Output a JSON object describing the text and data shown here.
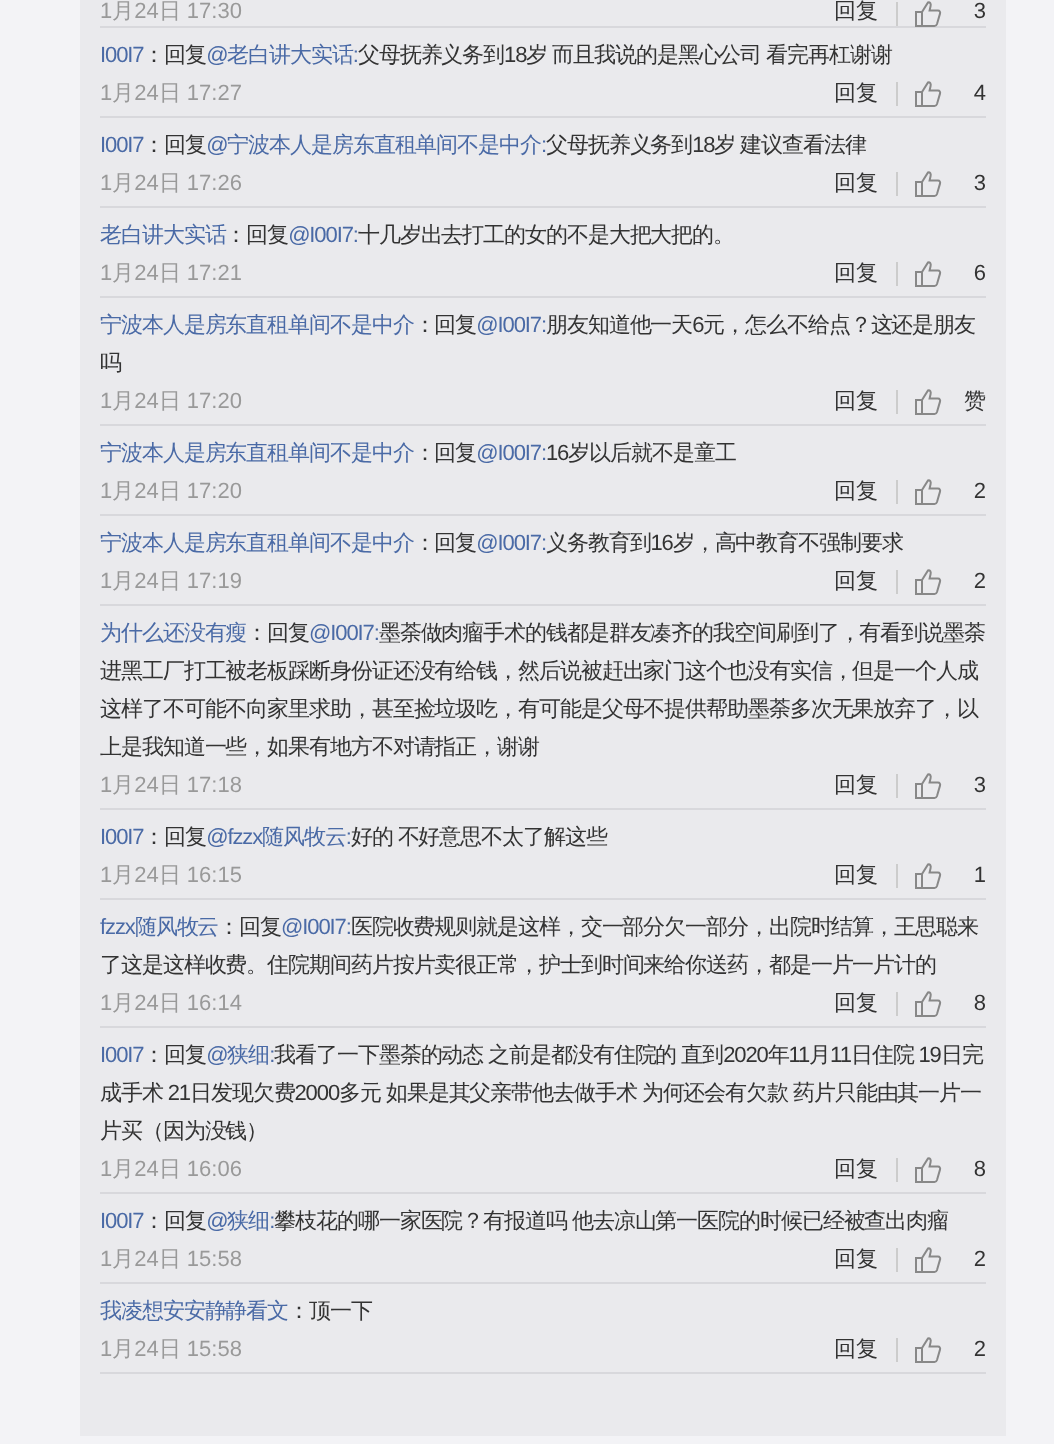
{
  "partial_top": {
    "time": "1月24日 17:30",
    "reply": "回复",
    "likes": "3"
  },
  "comments": [
    {
      "user": "I00I7",
      "reply_word": "：回复",
      "mention": "@老白讲大实话:",
      "text": "父母抚养义务到18岁 而且我说的是黑心公司 看完再杠谢谢",
      "time": "1月24日 17:27",
      "reply": "回复",
      "likes": "4"
    },
    {
      "user": "I00I7",
      "reply_word": "：回复",
      "mention": "@宁波本人是房东直租单间不是中介:",
      "text": "父母抚养义务到18岁 建议查看法律",
      "time": "1月24日 17:26",
      "reply": "回复",
      "likes": "3"
    },
    {
      "user": "老白讲大实话",
      "reply_word": "：回复",
      "mention": "@I00I7:",
      "text": "十几岁出去打工的女的不是大把大把的。",
      "time": "1月24日 17:21",
      "reply": "回复",
      "likes": "6"
    },
    {
      "user": "宁波本人是房东直租单间不是中介",
      "reply_word": "：回复",
      "mention": "@I00I7:",
      "text": "朋友知道他一天6元，怎么不给点？这还是朋友吗",
      "time": "1月24日 17:20",
      "reply": "回复",
      "likes": "赞"
    },
    {
      "user": "宁波本人是房东直租单间不是中介",
      "reply_word": "：回复",
      "mention": "@I00I7:",
      "text": "16岁以后就不是童工",
      "time": "1月24日 17:20",
      "reply": "回复",
      "likes": "2"
    },
    {
      "user": "宁波本人是房东直租单间不是中介",
      "reply_word": "：回复",
      "mention": "@I00I7:",
      "text": "义务教育到16岁，高中教育不强制要求",
      "time": "1月24日 17:19",
      "reply": "回复",
      "likes": "2"
    },
    {
      "user": "为什么还没有瘦",
      "reply_word": "：回复",
      "mention": "@I00I7:",
      "text": "墨荼做肉瘤手术的钱都是群友凑齐的我空间刷到了，有看到说墨荼进黑工厂打工被老板踩断身份证还没有给钱，然后说被赶出家门这个也没有实信，但是一个人成这样了不可能不向家里求助，甚至捡垃圾吃，有可能是父母不提供帮助墨荼多次无果放弃了，以上是我知道一些，如果有地方不对请指正，谢谢",
      "time": "1月24日 17:18",
      "reply": "回复",
      "likes": "3"
    },
    {
      "user": "I00I7",
      "reply_word": "：回复",
      "mention": "@fzzx随风牧云:",
      "text": "好的 不好意思不太了解这些",
      "time": "1月24日 16:15",
      "reply": "回复",
      "likes": "1"
    },
    {
      "user": "fzzx随风牧云",
      "reply_word": "：回复",
      "mention": "@I00I7:",
      "text": "医院收费规则就是这样，交一部分欠一部分，出院时结算，王思聪来了这是这样收费。住院期间药片按片卖很正常，护士到时间来给你送药，都是一片一片计的",
      "time": "1月24日 16:14",
      "reply": "回复",
      "likes": "8"
    },
    {
      "user": "I00I7",
      "reply_word": "：回复",
      "mention": "@狭细:",
      "text": "我看了一下墨荼的动态 之前是都没有住院的 直到2020年11月11日住院 19日完成手术 21日发现欠费2000多元 如果是其父亲带他去做手术 为何还会有欠款 药片只能由其一片一片买（因为没钱）",
      "time": "1月24日 16:06",
      "reply": "回复",
      "likes": "8"
    },
    {
      "user": "I00I7",
      "reply_word": "：回复",
      "mention": "@狭细:",
      "text": "攀枝花的哪一家医院？有报道吗 他去凉山第一医院的时候已经被查出肉瘤",
      "time": "1月24日 15:58",
      "reply": "回复",
      "likes": "2"
    },
    {
      "user": "我凌想安安静静看文",
      "reply_word": "：",
      "text": "顶一下",
      "time": "1月24日 15:58",
      "reply": "回复",
      "likes": "2"
    }
  ]
}
